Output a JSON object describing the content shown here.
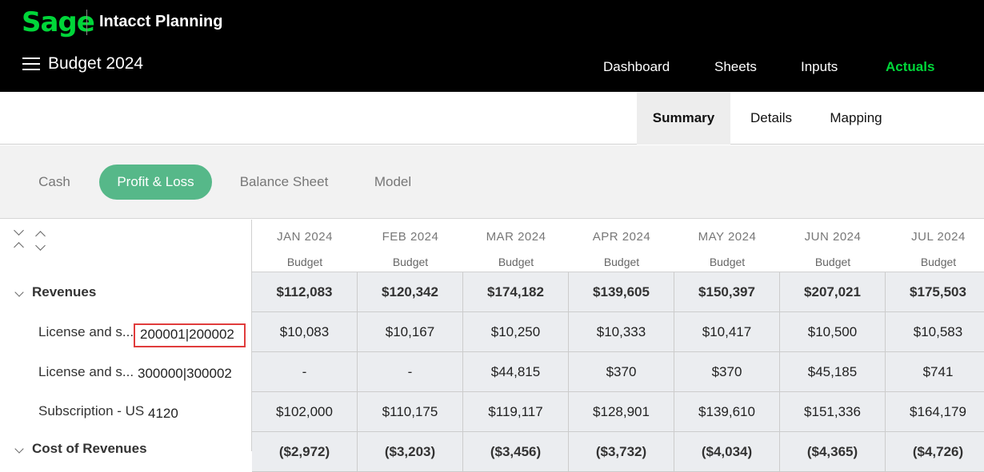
{
  "header": {
    "logo": "Sage",
    "product": "Intacct Planning",
    "page_title": "Budget 2024",
    "nav": [
      "Dashboard",
      "Sheets",
      "Inputs",
      "Actuals"
    ],
    "active_nav": "Actuals"
  },
  "subtabs": [
    "Summary",
    "Details",
    "Mapping"
  ],
  "active_subtab": "Summary",
  "pills": [
    "Cash",
    "Profit & Loss",
    "Balance Sheet",
    "Model"
  ],
  "active_pill": "Profit & Loss",
  "columns": [
    {
      "month": "JAN 2024",
      "sub": "Budget"
    },
    {
      "month": "FEB 2024",
      "sub": "Budget"
    },
    {
      "month": "MAR 2024",
      "sub": "Budget"
    },
    {
      "month": "APR 2024",
      "sub": "Budget"
    },
    {
      "month": "MAY 2024",
      "sub": "Budget"
    },
    {
      "month": "JUN 2024",
      "sub": "Budget"
    },
    {
      "month": "JUL 2024",
      "sub": "Budget"
    }
  ],
  "rows": [
    {
      "label": "Revenues",
      "account": "",
      "total": true,
      "values": [
        "$112,083",
        "$120,342",
        "$174,182",
        "$139,605",
        "$150,397",
        "$207,021",
        "$175,503"
      ]
    },
    {
      "label": "License and s...",
      "account": "200001|200002",
      "total": false,
      "values": [
        "$10,083",
        "$10,167",
        "$10,250",
        "$10,333",
        "$10,417",
        "$10,500",
        "$10,583"
      ]
    },
    {
      "label": "License and s...",
      "account": "300000|300002",
      "total": false,
      "values": [
        "-",
        "-",
        "$44,815",
        "$370",
        "$370",
        "$45,185",
        "$741"
      ]
    },
    {
      "label": "Subscription - US",
      "account": "4120",
      "total": false,
      "values": [
        "$102,000",
        "$110,175",
        "$119,117",
        "$128,901",
        "$139,610",
        "$151,336",
        "$164,179"
      ]
    },
    {
      "label": "Cost of Revenues",
      "account": "",
      "total": true,
      "values": [
        "($2,972)",
        "($3,203)",
        "($3,456)",
        "($3,732)",
        "($4,034)",
        "($4,365)",
        "($4,726)"
      ]
    }
  ],
  "colors": {
    "brand_green": "#00d639",
    "pill_active": "#56b889",
    "highlight_box": "#e03c3c"
  }
}
